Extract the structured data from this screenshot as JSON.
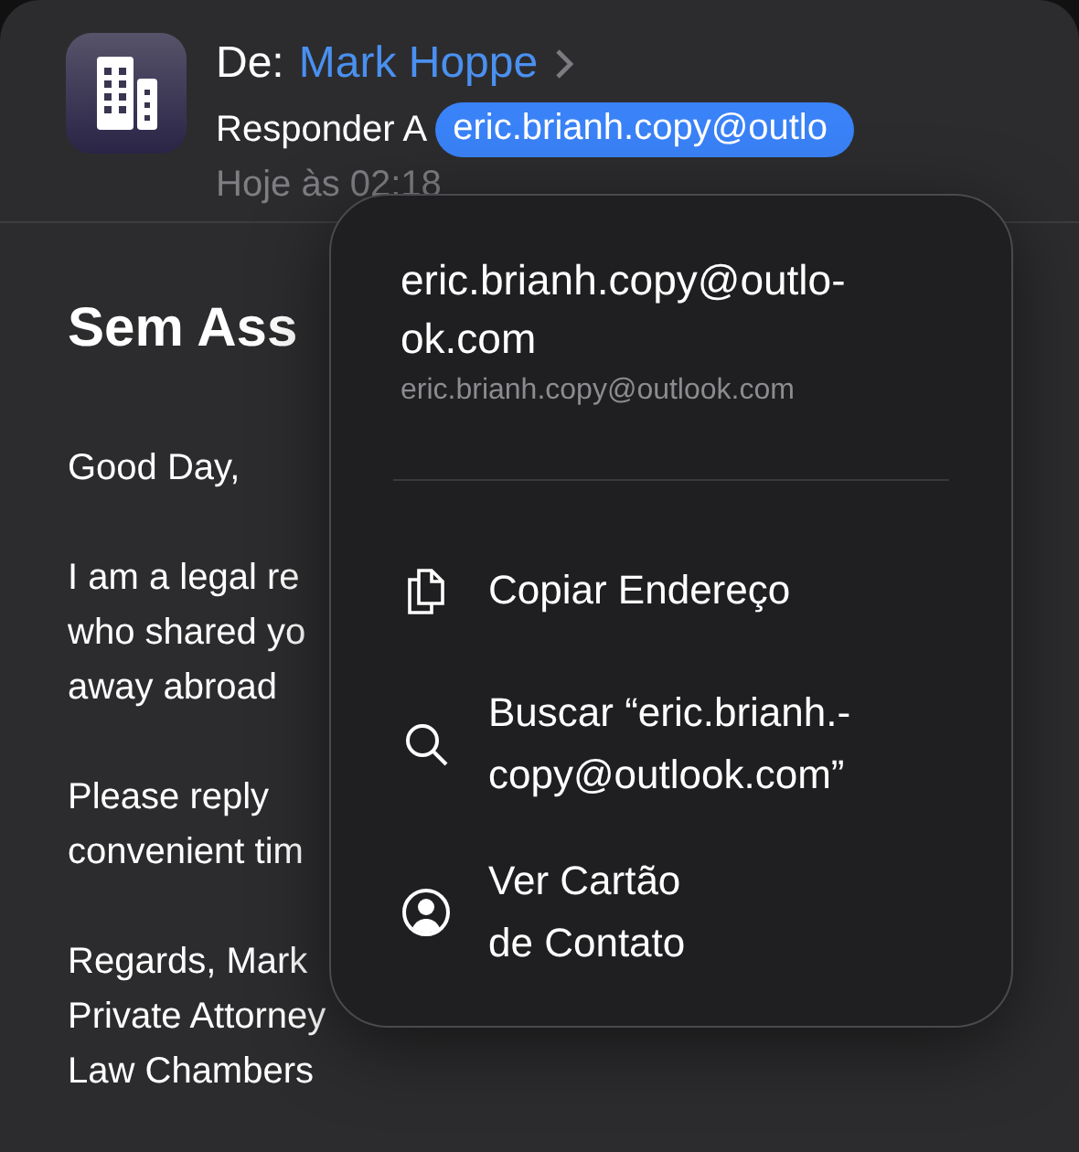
{
  "header": {
    "from_label": "De:",
    "sender": "Mark Hoppe",
    "reply_to_label": "Responder A",
    "reply_to_address": "eric.brianh.copy@outlo",
    "time": "Hoje às 02:18"
  },
  "subject": "Sem Ass",
  "body": [
    [
      "Good Day,"
    ],
    [
      "I am a legal re",
      "who shared yo",
      "away abroad"
    ],
    [
      "Please reply",
      "convenient tim"
    ],
    [
      "Regards, Mark",
      "Private Attorney",
      "Law Chambers"
    ]
  ],
  "menu": {
    "title": "eric.brianh.copy@outlo-\nok.com",
    "subtitle": "eric.brianh.copy@outlook.com",
    "items": [
      {
        "kind": "copy",
        "label": "Copiar Endereço"
      },
      {
        "kind": "search",
        "label": "Buscar “eric.brianh.-\ncopy@outlook.com”"
      },
      {
        "kind": "contact",
        "label": "Ver Cartão\nde Contato"
      }
    ]
  }
}
